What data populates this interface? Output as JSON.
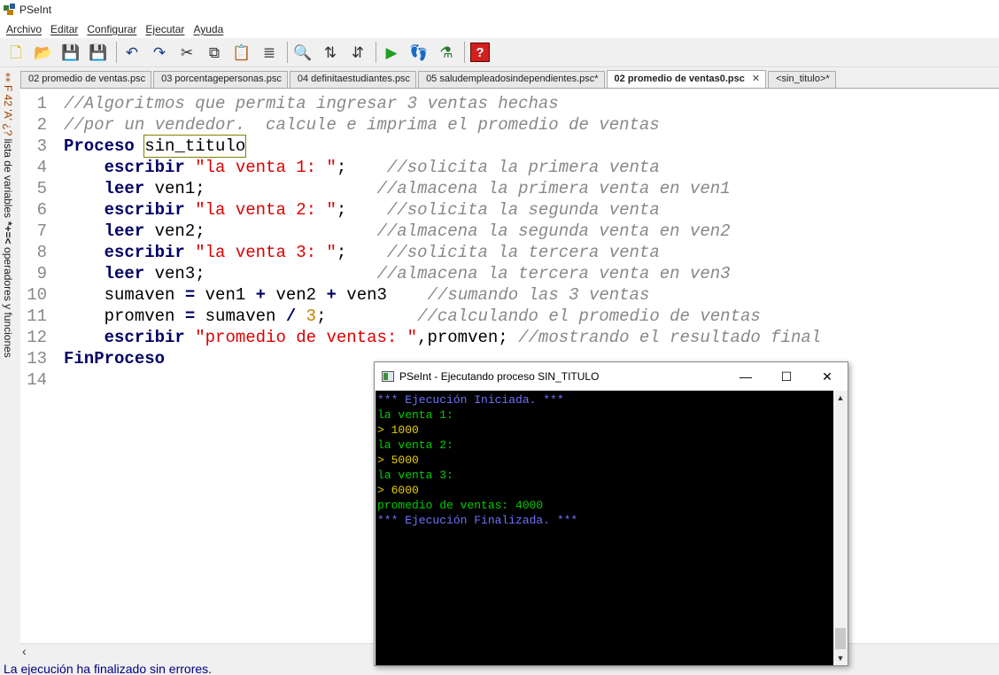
{
  "window": {
    "title": "PSeInt"
  },
  "menu": [
    "Archivo",
    "Editar",
    "Configurar",
    "Ejecutar",
    "Ayuda"
  ],
  "toolbar": [
    {
      "name": "new-file-icon",
      "glyph": "🗋",
      "color": "#d8b200"
    },
    {
      "name": "open-file-icon",
      "glyph": "📂",
      "color": "#c08000"
    },
    {
      "name": "save-icon",
      "glyph": "💾",
      "color": "#a02020"
    },
    {
      "name": "save-as-icon",
      "glyph": "💾",
      "color": "#c02020"
    },
    {
      "sep": true
    },
    {
      "name": "undo-icon",
      "glyph": "↶",
      "color": "#1a3a8a"
    },
    {
      "name": "redo-icon",
      "glyph": "↷",
      "color": "#1a3a8a"
    },
    {
      "name": "cut-icon",
      "glyph": "✂",
      "color": "#333"
    },
    {
      "name": "copy-icon",
      "glyph": "⧉",
      "color": "#333"
    },
    {
      "name": "paste-icon",
      "glyph": "📋",
      "color": "#8a5a20"
    },
    {
      "name": "indent-icon",
      "glyph": "≣",
      "color": "#555"
    },
    {
      "sep": true
    },
    {
      "name": "find-icon",
      "glyph": "🔍",
      "color": "#333"
    },
    {
      "name": "find-previous-icon",
      "glyph": "⇅",
      "color": "#333"
    },
    {
      "name": "find-next-icon",
      "glyph": "⇵",
      "color": "#333"
    },
    {
      "sep": true
    },
    {
      "name": "run-icon",
      "glyph": "▶",
      "color": "#20a020"
    },
    {
      "name": "step-by-step-icon",
      "glyph": "👣",
      "color": "#c07040"
    },
    {
      "name": "flowchart-icon",
      "glyph": "⚗",
      "color": "#2a7a2a"
    },
    {
      "sep": true
    },
    {
      "name": "help-icon",
      "glyph": "?",
      "color": "#fff"
    }
  ],
  "side_panel": {
    "vars_label": "lista de variables",
    "ops_label": "operadores y funciones",
    "vars_symbols": "⁑F 42 'A' ¿?",
    "ops_symbols": "*+=<"
  },
  "tabs": [
    {
      "label": "02 promedio de ventas.psc",
      "active": false
    },
    {
      "label": "03 porcentagepersonas.psc",
      "active": false
    },
    {
      "label": "04 definitaestudiantes.psc",
      "active": false
    },
    {
      "label": "05 saludempleadosindependientes.psc*",
      "active": false
    },
    {
      "label": "02 promedio de ventas0.psc",
      "active": true,
      "close": "✕"
    },
    {
      "label": "<sin_titulo>*",
      "active": false
    }
  ],
  "code_lines": [
    {
      "n": "1",
      "segs": [
        {
          "c": "cm",
          "t": "//Algoritmos que permita ingresar 3 ventas hechas"
        }
      ]
    },
    {
      "n": "2",
      "segs": [
        {
          "c": "cm",
          "t": "//por un vendedor.  calcule e imprima el promedio de ventas"
        }
      ]
    },
    {
      "n": "3",
      "segs": [
        {
          "c": "kw",
          "t": "Proceso"
        },
        {
          "c": "txt",
          "t": " "
        },
        {
          "c": "txt hl",
          "t": "sin_titulo"
        }
      ]
    },
    {
      "n": "4",
      "segs": [
        {
          "c": "txt",
          "t": "    "
        },
        {
          "c": "kw",
          "t": "escribir"
        },
        {
          "c": "txt",
          "t": " "
        },
        {
          "c": "str",
          "t": "\"la venta 1: \""
        },
        {
          "c": "txt",
          "t": ";    "
        },
        {
          "c": "cm",
          "t": "//solicita la primera venta"
        }
      ]
    },
    {
      "n": "5",
      "segs": [
        {
          "c": "txt",
          "t": "    "
        },
        {
          "c": "kw",
          "t": "leer"
        },
        {
          "c": "txt",
          "t": " ven1;                 "
        },
        {
          "c": "cm",
          "t": "//almacena la primera venta en ven1"
        }
      ]
    },
    {
      "n": "6",
      "segs": [
        {
          "c": "txt",
          "t": "    "
        },
        {
          "c": "kw",
          "t": "escribir"
        },
        {
          "c": "txt",
          "t": " "
        },
        {
          "c": "str",
          "t": "\"la venta 2: \""
        },
        {
          "c": "txt",
          "t": ";    "
        },
        {
          "c": "cm",
          "t": "//solicita la segunda venta"
        }
      ]
    },
    {
      "n": "7",
      "segs": [
        {
          "c": "txt",
          "t": "    "
        },
        {
          "c": "kw",
          "t": "leer"
        },
        {
          "c": "txt",
          "t": " ven2;                 "
        },
        {
          "c": "cm",
          "t": "//almacena la segunda venta en ven2"
        }
      ]
    },
    {
      "n": "8",
      "segs": [
        {
          "c": "txt",
          "t": "    "
        },
        {
          "c": "kw",
          "t": "escribir"
        },
        {
          "c": "txt",
          "t": " "
        },
        {
          "c": "str",
          "t": "\"la venta 3: \""
        },
        {
          "c": "txt",
          "t": ";    "
        },
        {
          "c": "cm",
          "t": "//solicita la tercera venta"
        }
      ]
    },
    {
      "n": "9",
      "segs": [
        {
          "c": "txt",
          "t": "    "
        },
        {
          "c": "kw",
          "t": "leer"
        },
        {
          "c": "txt",
          "t": " ven3;                 "
        },
        {
          "c": "cm",
          "t": "//almacena la tercera venta en ven3"
        }
      ]
    },
    {
      "n": "10",
      "segs": [
        {
          "c": "txt",
          "t": "    sumaven "
        },
        {
          "c": "kw",
          "t": "="
        },
        {
          "c": "txt",
          "t": " ven1 "
        },
        {
          "c": "kw",
          "t": "+"
        },
        {
          "c": "txt",
          "t": " ven2 "
        },
        {
          "c": "kw",
          "t": "+"
        },
        {
          "c": "txt",
          "t": " ven3    "
        },
        {
          "c": "cm",
          "t": "//sumando las 3 ventas"
        }
      ]
    },
    {
      "n": "11",
      "segs": [
        {
          "c": "txt",
          "t": "    promven "
        },
        {
          "c": "kw",
          "t": "="
        },
        {
          "c": "txt",
          "t": " sumaven "
        },
        {
          "c": "kw",
          "t": "/"
        },
        {
          "c": "txt",
          "t": " "
        },
        {
          "c": "nm",
          "t": "3"
        },
        {
          "c": "txt",
          "t": ";         "
        },
        {
          "c": "cm",
          "t": "//calculando el promedio de ventas"
        }
      ]
    },
    {
      "n": "12",
      "segs": [
        {
          "c": "txt",
          "t": "    "
        },
        {
          "c": "kw",
          "t": "escribir"
        },
        {
          "c": "txt",
          "t": " "
        },
        {
          "c": "str",
          "t": "\"promedio de ventas: \""
        },
        {
          "c": "txt",
          "t": ",promven; "
        },
        {
          "c": "cm",
          "t": "//mostrando el resultado final"
        }
      ]
    },
    {
      "n": "13",
      "segs": [
        {
          "c": "kw",
          "t": "FinProceso"
        }
      ]
    },
    {
      "n": "14",
      "segs": []
    }
  ],
  "status": "La ejecución ha finalizado sin errores.",
  "console": {
    "title": "PSeInt - Ejecutando proceso SIN_TITULO",
    "buttons": {
      "minimize": "—",
      "maximize": "☐",
      "close": "✕"
    },
    "lines": [
      {
        "c": "c-blue",
        "t": "*** Ejecución Iniciada. ***"
      },
      {
        "c": "c-green",
        "t": "la venta 1:"
      },
      {
        "c": "c-yellow",
        "t": "> 1000"
      },
      {
        "c": "c-green",
        "t": "la venta 2:"
      },
      {
        "c": "c-yellow",
        "t": "> 5000"
      },
      {
        "c": "c-green",
        "t": "la venta 3:"
      },
      {
        "c": "c-yellow",
        "t": "> 6000"
      },
      {
        "c": "c-green",
        "t": "promedio de ventas: 4000"
      },
      {
        "c": "c-blue",
        "t": "*** Ejecución Finalizada. ***"
      }
    ]
  }
}
